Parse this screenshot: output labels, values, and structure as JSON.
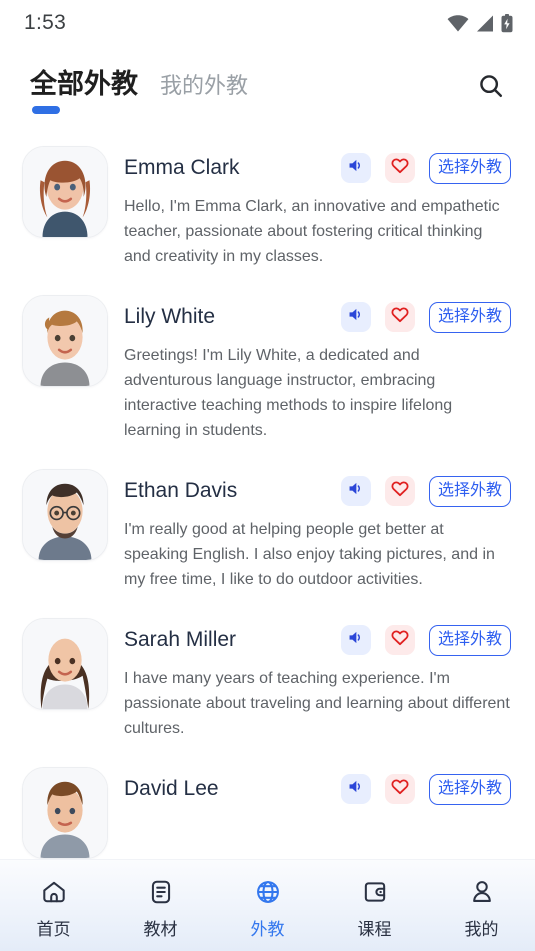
{
  "statusbar": {
    "time": "1:53",
    "icons": [
      "wifi-icon",
      "cellular-signal-icon",
      "battery-charging-icon"
    ]
  },
  "header": {
    "tabs": [
      {
        "label": "全部外教",
        "active": true
      },
      {
        "label": "我的外教",
        "active": false
      }
    ],
    "search_icon": "search-icon",
    "accent_color": "#2f6fe4"
  },
  "teachers": [
    {
      "name": "Emma Clark",
      "description": "Hello, I'm Emma Clark, an innovative and empathetic teacher, passionate about fostering critical thinking and creativity in my classes.",
      "speaker_icon": "speaker-icon",
      "favorite_icon": "heart-icon",
      "select_label": "选择外教",
      "avatar": "avatar-emma-clark"
    },
    {
      "name": "Lily White",
      "description": "Greetings! I'm Lily White, a dedicated and adventurous language instructor, embracing interactive teaching methods to inspire lifelong learning in students.",
      "speaker_icon": "speaker-icon",
      "favorite_icon": "heart-icon",
      "select_label": "选择外教",
      "avatar": "avatar-lily-white"
    },
    {
      "name": "Ethan Davis",
      "description": "I'm really good at helping people get better at speaking English. I also enjoy taking pictures, and in my free time, I like to do outdoor activities.",
      "speaker_icon": "speaker-icon",
      "favorite_icon": "heart-icon",
      "select_label": "选择外教",
      "avatar": "avatar-ethan-davis"
    },
    {
      "name": "Sarah Miller",
      "description": "I have many years of teaching experience. I'm passionate about traveling and learning about different cultures.",
      "speaker_icon": "speaker-icon",
      "favorite_icon": "heart-icon",
      "select_label": "选择外教",
      "avatar": "avatar-sarah-miller"
    },
    {
      "name": "David Lee",
      "description": "",
      "speaker_icon": "speaker-icon",
      "favorite_icon": "heart-icon",
      "select_label": "选择外教",
      "avatar": "avatar-david-lee"
    }
  ],
  "bottomnav": {
    "items": [
      {
        "label": "首页",
        "icon": "home-icon",
        "active": false
      },
      {
        "label": "教材",
        "icon": "textbook-icon",
        "active": false
      },
      {
        "label": "外教",
        "icon": "globe-icon",
        "active": true
      },
      {
        "label": "课程",
        "icon": "wallet-icon",
        "active": false
      },
      {
        "label": "我的",
        "icon": "person-icon",
        "active": false
      }
    ],
    "active_color": "#3377ee",
    "inactive_color": "#2b3243"
  },
  "colors": {
    "speaker_chip_bg": "#e8eefe",
    "speaker_glyph": "#2b46d8",
    "heart_chip_bg": "#fdeaea",
    "heart_glyph": "#e02020",
    "select_border": "#3663f0",
    "name_text": "#242f44",
    "desc_text": "#5f6368"
  }
}
